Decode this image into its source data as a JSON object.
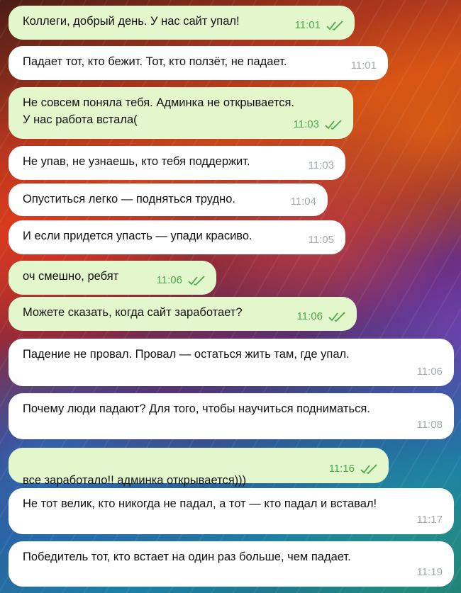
{
  "messages": [
    {
      "text": "Коллеги, добрый день. У нас сайт упал!",
      "time": "11:01",
      "direction": "outgoing",
      "read": true
    },
    {
      "text": "Падает тот, кто бежит. Тот, кто ползёт, не падает.",
      "time": "11:01",
      "direction": "incoming",
      "read": false
    },
    {
      "text": "Не совсем поняла тебя. Админка не открывается.\nУ нас работа встала(",
      "time": "11:03",
      "direction": "outgoing",
      "read": true
    },
    {
      "text": "Не упав, не узнаешь, кто тебя поддержит.",
      "time": "11:03",
      "direction": "incoming",
      "read": false
    },
    {
      "text": "Опуститься легко — подняться трудно.",
      "time": "11:04",
      "direction": "incoming",
      "read": false
    },
    {
      "text": "И если придется упасть — упади красиво.",
      "time": "11:05",
      "direction": "incoming",
      "read": false
    },
    {
      "text": "оч смешно, ребят",
      "time": "11:06",
      "direction": "outgoing",
      "read": true
    },
    {
      "text": "Можете сказать, когда сайт заработает?",
      "time": "11:06",
      "direction": "outgoing",
      "read": true
    },
    {
      "text": "Падение не провал. Провал — остаться жить там, где упал.",
      "time": "11:06",
      "direction": "incoming",
      "read": false
    },
    {
      "text": "Почему люди падают? Для того, чтобы научиться подниматься.",
      "time": "11:08",
      "direction": "incoming",
      "read": false
    },
    {
      "text": "все заработало!! админка открывается)))",
      "time": "11:16",
      "direction": "outgoing",
      "read": true,
      "emoji": "hugging-face-emoji"
    },
    {
      "text": "Не тот велик, кто никогда не падал, а тот — кто падал и вставал!",
      "time": "11:17",
      "direction": "incoming",
      "read": false
    },
    {
      "text": "Победитель тот, кто встает на один раз больше, чем падает.",
      "time": "11:19",
      "direction": "incoming",
      "read": false
    }
  ],
  "icons": {
    "read_receipt": "double-check-icon"
  },
  "colors": {
    "outgoing_bubble": "#e2f7cb",
    "incoming_bubble": "#ffffff",
    "outgoing_time": "#4da94a",
    "incoming_time": "#a4a9ae"
  }
}
